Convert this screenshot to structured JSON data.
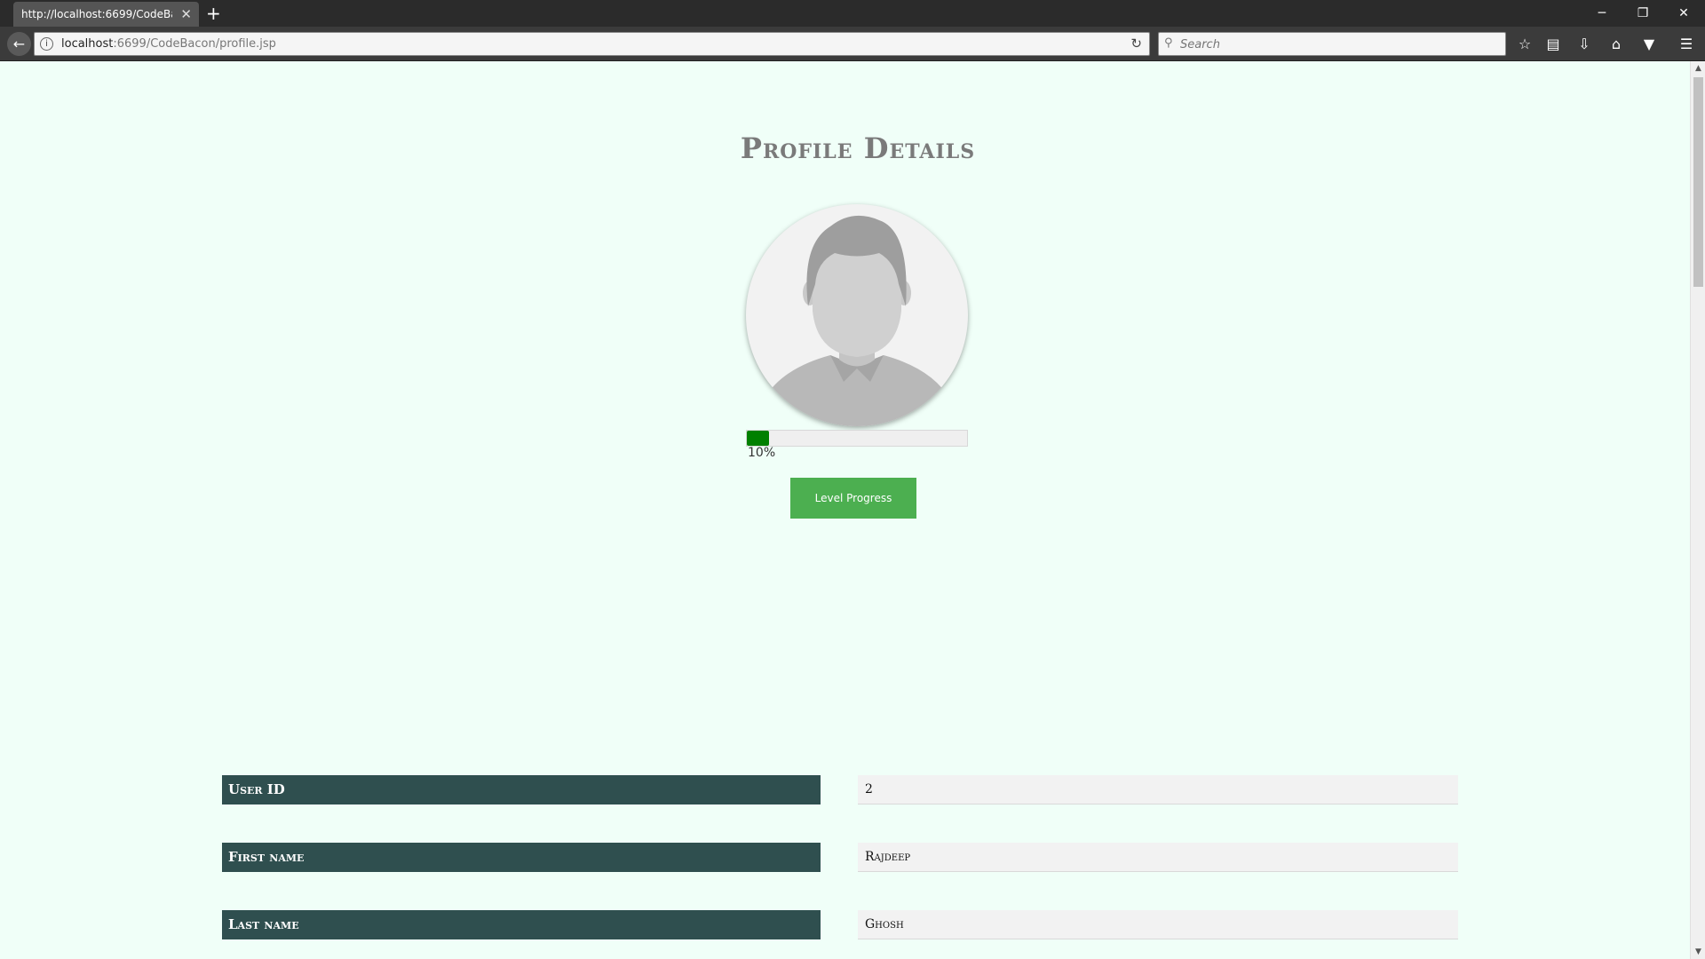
{
  "browser": {
    "tab_title": "http://localhost:6699/CodeBacon/profile.jsp",
    "tab_close": "✕",
    "new_tab": "+",
    "window_controls": {
      "minimize": "─",
      "restore": "❐",
      "close": "✕"
    },
    "url_host": "localhost",
    "url_path": ":6699/CodeBacon/profile.jsp",
    "search_placeholder": "Search",
    "toolbar_icons": [
      "star-icon",
      "reading-list-icon",
      "download-icon",
      "home-icon",
      "pocket-icon",
      "menu-icon"
    ]
  },
  "page": {
    "title": "Profile Details",
    "progress": {
      "percent": 10,
      "label": "10%"
    },
    "level_button": "Level Progress",
    "fields": [
      {
        "label": "User ID",
        "value": "2"
      },
      {
        "label": "First name",
        "value": "Rajdeep"
      },
      {
        "label": "Last name",
        "value": "Ghosh"
      }
    ]
  },
  "colors": {
    "page_background": "#f0fff8",
    "label_background": "#2f4f4f",
    "button_green": "#4caf50",
    "progress_fill": "#008000",
    "title_gray": "#7a7a7a"
  }
}
